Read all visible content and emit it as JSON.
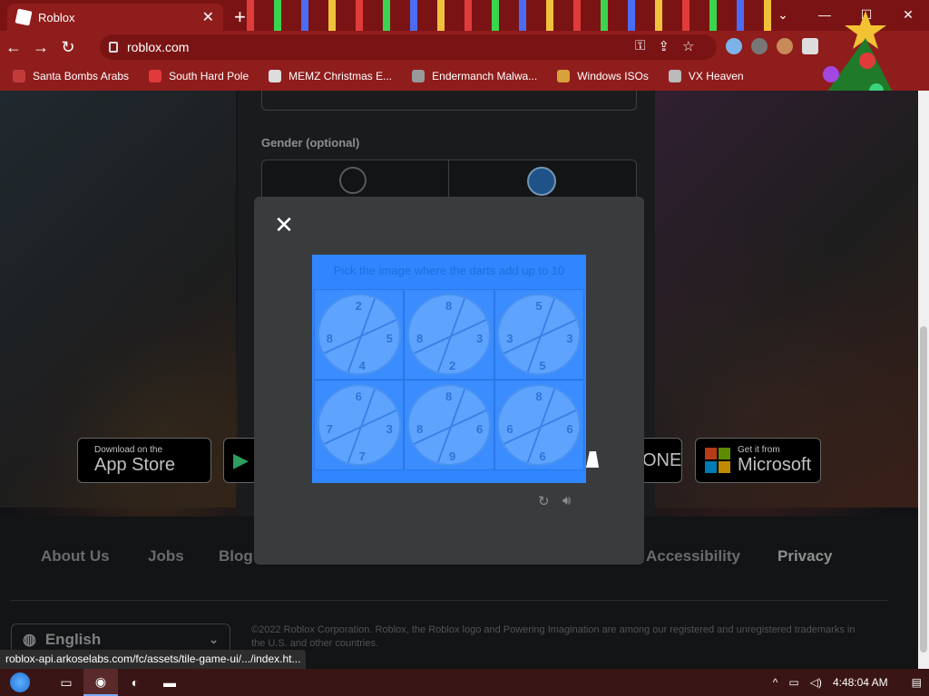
{
  "browser": {
    "tab_title": "Roblox",
    "url": "roblox.com",
    "bookmarks": [
      {
        "label": "Santa Bombs Arabs",
        "color": "#c23b3b"
      },
      {
        "label": "South Hard Pole",
        "color": "#e03a3a"
      },
      {
        "label": "MEMZ Christmas E...",
        "color": "#dddddd"
      },
      {
        "label": "Endermanch Malwa...",
        "color": "#999999"
      },
      {
        "label": "Windows ISOs",
        "color": "#d9a13b"
      },
      {
        "label": "VX Heaven",
        "color": "#bbbbbb"
      }
    ],
    "status_url": "roblox-api.arkoselabs.com/fc/assets/tile-game-ui/.../index.ht..."
  },
  "signup": {
    "gender_label": "Gender (optional)"
  },
  "app_buttons": {
    "apple_small": "Download on the",
    "apple_big": "App Store",
    "xbox_big": "ONE",
    "ms_small": "Get it from",
    "ms_big": "Microsoft"
  },
  "footer": {
    "links": [
      "About Us",
      "Jobs",
      "Blog",
      "Accessibility",
      "Privacy"
    ],
    "language": "English",
    "copyright": "©2022 Roblox Corporation. Roblox, the Roblox logo and Powering Imagination are among our registered and unregistered trademarks in the U.S. and other countries."
  },
  "captcha": {
    "instruction": "Pick the image where the darts add up to 10",
    "boards": [
      [
        "2",
        "8",
        "4",
        "5"
      ],
      [
        "8",
        "8",
        "2",
        "3"
      ],
      [
        "5",
        "3",
        "5",
        "3"
      ],
      [
        "6",
        "7",
        "7",
        "3"
      ],
      [
        "8",
        "8",
        "9",
        "6"
      ],
      [
        "8",
        "6",
        "6",
        "6"
      ]
    ]
  },
  "taskbar": {
    "time": "4:48:04 AM"
  },
  "colors": {
    "chrome_bg": "#8f1d1c",
    "captcha_blue": "#2f86ff",
    "modal_bg": "#393b3d"
  }
}
